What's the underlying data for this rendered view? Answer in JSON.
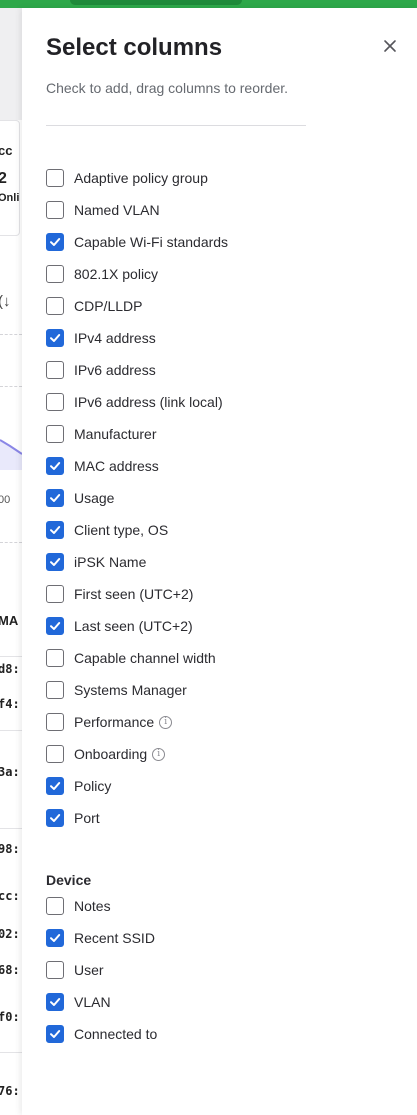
{
  "background": {
    "fragments": [
      {
        "text": "cc",
        "style": "bold"
      },
      {
        "text": "2",
        "style": "bold"
      },
      {
        "text": "Onli",
        "style": "bold"
      },
      {
        "text": "(↓",
        "style": ""
      },
      {
        "text": "00",
        "style": ""
      },
      {
        "text": "MA",
        "style": "bold"
      },
      {
        "text": "d8:",
        "style": "mono"
      },
      {
        "text": "f4:",
        "style": "mono"
      },
      {
        "text": "3a:",
        "style": "mono"
      },
      {
        "text": "98:",
        "style": "mono"
      },
      {
        "text": "cc:",
        "style": "mono"
      },
      {
        "text": "02:",
        "style": "mono"
      },
      {
        "text": "68:",
        "style": "mono"
      },
      {
        "text": "f0:",
        "style": "mono"
      },
      {
        "text": "76:",
        "style": "mono"
      }
    ]
  },
  "drawer": {
    "title": "Select columns",
    "subtitle": "Check to add, drag columns to reorder.",
    "options": [
      {
        "label": "Adaptive policy group",
        "checked": false,
        "info": false
      },
      {
        "label": "Named VLAN",
        "checked": false,
        "info": false
      },
      {
        "label": "Capable Wi-Fi standards",
        "checked": true,
        "info": false
      },
      {
        "label": "802.1X policy",
        "checked": false,
        "info": false
      },
      {
        "label": "CDP/LLDP",
        "checked": false,
        "info": false
      },
      {
        "label": "IPv4 address",
        "checked": true,
        "info": false
      },
      {
        "label": "IPv6 address",
        "checked": false,
        "info": false
      },
      {
        "label": "IPv6 address (link local)",
        "checked": false,
        "info": false
      },
      {
        "label": "Manufacturer",
        "checked": false,
        "info": false
      },
      {
        "label": "MAC address",
        "checked": true,
        "info": false
      },
      {
        "label": "Usage",
        "checked": true,
        "info": false
      },
      {
        "label": "Client type, OS",
        "checked": true,
        "info": false
      },
      {
        "label": "iPSK Name",
        "checked": true,
        "info": false
      },
      {
        "label": "First seen (UTC+2)",
        "checked": false,
        "info": false
      },
      {
        "label": "Last seen (UTC+2)",
        "checked": true,
        "info": false
      },
      {
        "label": "Capable channel width",
        "checked": false,
        "info": false
      },
      {
        "label": "Systems Manager",
        "checked": false,
        "info": false
      },
      {
        "label": "Performance",
        "checked": false,
        "info": true
      },
      {
        "label": "Onboarding",
        "checked": false,
        "info": true
      },
      {
        "label": "Policy",
        "checked": true,
        "info": false
      },
      {
        "label": "Port",
        "checked": true,
        "info": false
      }
    ],
    "device_section": {
      "heading": "Device",
      "options": [
        {
          "label": "Notes",
          "checked": false
        },
        {
          "label": "Recent SSID",
          "checked": true
        },
        {
          "label": "User",
          "checked": false
        },
        {
          "label": "VLAN",
          "checked": true
        },
        {
          "label": "Connected to",
          "checked": true
        }
      ]
    }
  },
  "colors": {
    "accent": "#2168d9",
    "top_bar": "#2ea84a"
  },
  "icons": {
    "close": "close-icon",
    "checkmark": "checkmark-icon",
    "info": "info-icon"
  }
}
